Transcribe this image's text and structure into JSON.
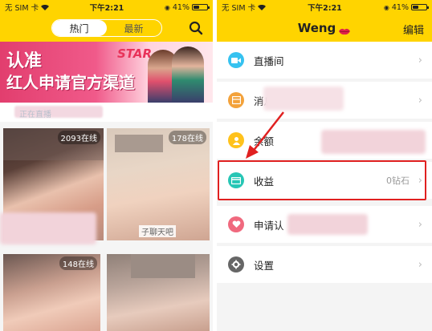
{
  "left_screen": {
    "status": {
      "carrier": "无 SIM 卡",
      "time": "下午2:21",
      "battery": "41%",
      "battery_level": 0.41
    },
    "tabs": [
      {
        "label": "热门",
        "active": true
      },
      {
        "label": "最新",
        "active": false
      }
    ],
    "banner": {
      "line1": "认准",
      "line2": "红人申请官方渠道",
      "star": "STAR"
    },
    "section_label": "正在直播",
    "cards": [
      {
        "badge": "2093在线",
        "caption": ""
      },
      {
        "badge": "178在线",
        "caption": "子聊天吧"
      },
      {
        "badge": "148在线",
        "caption": ""
      },
      {
        "badge": "",
        "caption": ""
      }
    ]
  },
  "right_screen": {
    "status": {
      "carrier": "无 SIM 卡",
      "time": "下午2:21",
      "battery": "41%",
      "battery_level": 0.41
    },
    "title": "Weng",
    "edit_label": "编辑",
    "menu": [
      {
        "label": "直播间",
        "value": "",
        "icon": "video-camera-icon",
        "color": "#36c2f0"
      },
      {
        "label": "消息",
        "value": "",
        "icon": "message-box-icon",
        "color": "#f3a23b"
      },
      {
        "label": "余额",
        "value": "",
        "icon": "person-icon",
        "color": "#ffc21c"
      },
      {
        "label": "收益",
        "value": "0钻石",
        "icon": "card-icon",
        "color": "#27c6b5"
      },
      {
        "label": "申请认",
        "value": "",
        "icon": "heart-badge-icon",
        "color": "#f0697e"
      },
      {
        "label": "设置",
        "value": "",
        "icon": "gear-icon",
        "color": "#666666"
      }
    ]
  },
  "colors": {
    "accent": "#ffd400",
    "highlight": "#e02020"
  }
}
